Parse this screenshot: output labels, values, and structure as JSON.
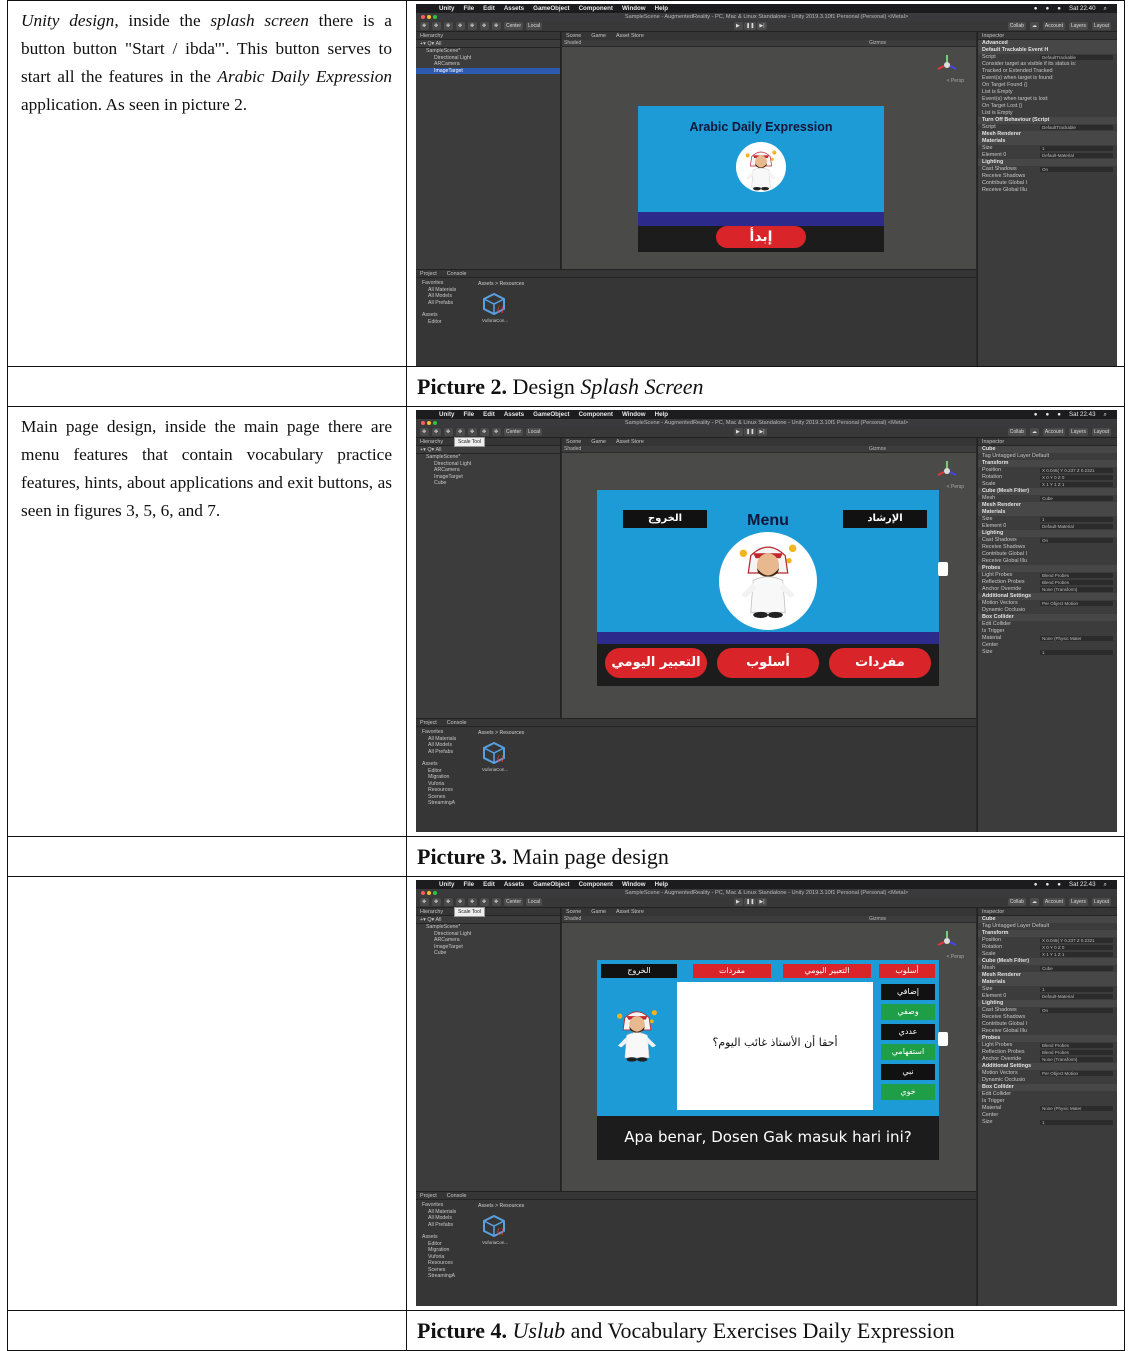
{
  "rows": [
    {
      "left_parts": [
        {
          "t": "Unity design",
          "i": true
        },
        {
          "t": ", inside the ",
          "i": false
        },
        {
          "t": "splash screen",
          "i": true
        },
        {
          "t": " there is a button button \"Start / ibda'\". This button serves to start all the features in the ",
          "i": false
        },
        {
          "t": "Arabic Daily Expression",
          "i": true
        },
        {
          "t": " application. As seen in picture 2.",
          "i": false
        }
      ],
      "caption_label": "Picture 2.",
      "caption_text": "Design ",
      "caption_italic": "Splash Screen"
    },
    {
      "left_parts": [
        {
          "t": "Main page design, inside the main page there are menu features that contain vocabulary practice features, hints, about applications and exit buttons, as seen in figures 3, 5, 6, and 7.",
          "i": false
        }
      ],
      "caption_label": "Picture 3.",
      "caption_text": "Main page design",
      "caption_italic": ""
    },
    {
      "left_parts": [],
      "caption_label": "Picture 4.",
      "caption_text": " and Vocabulary Exercises Daily Expression",
      "caption_italic": "Uslub"
    }
  ],
  "unity": {
    "menu": [
      "Unity",
      "File",
      "Edit",
      "Assets",
      "GameObject",
      "Component",
      "Window",
      "Help"
    ],
    "clock1": "Sat 22.40",
    "clock2": "Sat 22.43",
    "clock3": "Sat 22.43",
    "title": "SampleScene - AugmentedReality - PC, Mac & Linux Standalone - Unity 2019.3.10f1 Personal (Personal) <Metal>",
    "toolbar": {
      "center": "Center",
      "local": "Local",
      "collab": "Collab",
      "account": "Account",
      "layers": "Layers",
      "layout": "Layout",
      "scale_tool": "Scale Tool"
    },
    "hierarchy_label": "Hierarchy",
    "hierarchy_items": [
      "SampleScene*",
      "Directional Light",
      "ARCamera",
      "ImageTarget",
      "Cube"
    ],
    "scene_tabs": [
      "Scene",
      "Game",
      "Asset Store"
    ],
    "shaded": "Shaded",
    "gizmos": "Gizmos",
    "persp": "< Persp",
    "project_tabs": [
      "Project",
      "Console"
    ],
    "favorites": [
      "Favorites",
      "All Materials",
      "All Models",
      "All Prefabs"
    ],
    "assets_tree": [
      "Assets",
      "Editor",
      "Migration",
      "Vuforia",
      "Resources",
      "Scenes",
      "StreamingA"
    ],
    "breadcrumb": "Assets > Resources",
    "asset_file": "VuforiaCon...",
    "inspector_label": "Inspector",
    "inspector1": [
      "Advanced",
      "Default Trackable Event H",
      "Script",
      "Consider target as visible if its status is:",
      "Tracked or Extended Tracked",
      "Event(s) when target is found:",
      "On Target Found ()",
      "List is Empty",
      "Event(s) when target is lost:",
      "On Target Lost ()",
      "List is Empty",
      "Turn Off Behaviour (Script",
      "Script",
      "Mesh Renderer",
      "Materials",
      "Size",
      "Element 0",
      "Lighting",
      "Cast Shadows",
      "Receive Shadows",
      "Contribute Global I",
      "Receive Global Illu"
    ],
    "inspector2": [
      "Cube",
      "Tag Untagged  Layer Default",
      "Transform",
      "Position",
      "Rotation",
      "Scale",
      "Cube (Mesh Filter)",
      "Mesh",
      "Mesh Renderer",
      "Materials",
      "Size",
      "Element 0",
      "Lighting",
      "Cast Shadows",
      "Receive Shadows",
      "Contribute Global I",
      "Receive Global Illu",
      "Probes",
      "Light Probes",
      "Reflection Probes",
      "Anchor Override",
      "Additional Settings",
      "Motion Vectors",
      "Dynamic Occlusio",
      "Box Collider",
      "Edit Collider",
      "Is Trigger",
      "Material",
      "Center",
      "Size"
    ],
    "inspector_values": {
      "script1": "DefaultTrackable",
      "tracked": "Tracked or Extended Tracked",
      "script2": "TurnOffBehaviour",
      "size": "1",
      "cast": "On",
      "position": "X 0.046( Y 0.237 Z 0.2321",
      "rotation": "X 0    Y 0    Z 0",
      "scale": "X 1    Y 1    Z 1",
      "mesh": "Cube",
      "element0": "Default-Material",
      "light_probes": "Blend Probes",
      "reflection_probes": "Blend Probes",
      "anchor": "None (Transform)",
      "motion": "Per Object Motion",
      "material": "None (Physic Mater"
    }
  },
  "game1": {
    "title": "Arabic Daily Expression",
    "start_button": "إبدأ"
  },
  "game2": {
    "title": "Menu",
    "exit": "الخروج",
    "guide": "الإرشاد",
    "buttons": [
      "التعبير اليومي",
      "أسلوب",
      "مفردات"
    ]
  },
  "game3": {
    "top": [
      "الخروج",
      "مفردات",
      "التعبير اليومي",
      "أسلوب"
    ],
    "side": [
      "إضافي",
      "وصفي",
      "عددي",
      "استفهامي",
      "نبي",
      "خوي"
    ],
    "question": "أحقا أن الأستاذ غائب اليوم؟",
    "translation": "Apa benar, Dosen Gak masuk hari ini?"
  },
  "colors": {
    "sky": "#1d9bd6",
    "red": "#d92529",
    "green": "#1e9f47",
    "navy": "#2c2a8a",
    "unity_bg": "#2a2a2a"
  }
}
